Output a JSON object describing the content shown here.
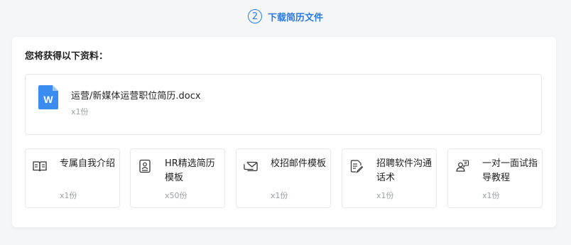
{
  "step": {
    "number": "2",
    "title": "下载简历文件"
  },
  "card": {
    "heading": "您将获得以下资料："
  },
  "file": {
    "icon": "word-doc-icon",
    "icon_letter": "W",
    "name": "运营/新媒体运营职位简历.docx",
    "qty": "x1份"
  },
  "bonuses": [
    {
      "icon": "book-icon",
      "title": "专属自我介绍",
      "qty": "x1份"
    },
    {
      "icon": "id-badge-icon",
      "title": "HR精选简历模板",
      "qty": "x50份"
    },
    {
      "icon": "mail-icon",
      "title": "校招邮件模板",
      "qty": "x1份"
    },
    {
      "icon": "doc-pen-icon",
      "title": "招聘软件沟通话术",
      "qty": "x1份"
    },
    {
      "icon": "user-chat-icon",
      "title": "一对一面试指导教程",
      "qty": "x1份"
    }
  ],
  "colors": {
    "accent": "#2c7be5",
    "word_blue": "#3b8cf0"
  }
}
